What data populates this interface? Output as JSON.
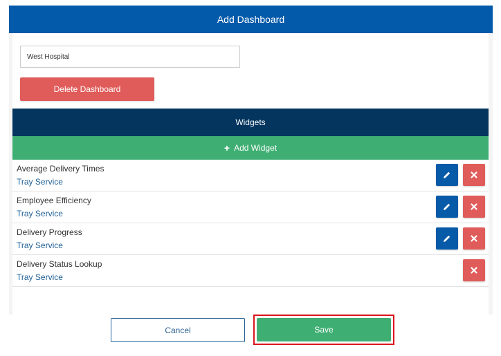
{
  "dialog": {
    "title": "Add Dashboard",
    "dashboard_name_value": "West Hospital",
    "delete_label": "Delete Dashboard"
  },
  "widgets": {
    "header": "Widgets",
    "add_label": "Add Widget",
    "items": [
      {
        "name": "Average Delivery Times",
        "type": "Tray Service",
        "editable": true
      },
      {
        "name": "Employee Efficiency",
        "type": "Tray Service",
        "editable": true
      },
      {
        "name": "Delivery Progress",
        "type": "Tray Service",
        "editable": true
      },
      {
        "name": "Delivery Status Lookup",
        "type": "Tray Service",
        "editable": false
      }
    ]
  },
  "footer": {
    "cancel_label": "Cancel",
    "save_label": "Save"
  },
  "colors": {
    "header_blue": "#035aaa",
    "widgets_navy": "#03355f",
    "green": "#3fae73",
    "red": "#e05c5a",
    "highlight_red": "#d9141c"
  },
  "icons": {
    "edit": "pencil-icon",
    "remove": "close-icon",
    "add": "plus-icon"
  }
}
